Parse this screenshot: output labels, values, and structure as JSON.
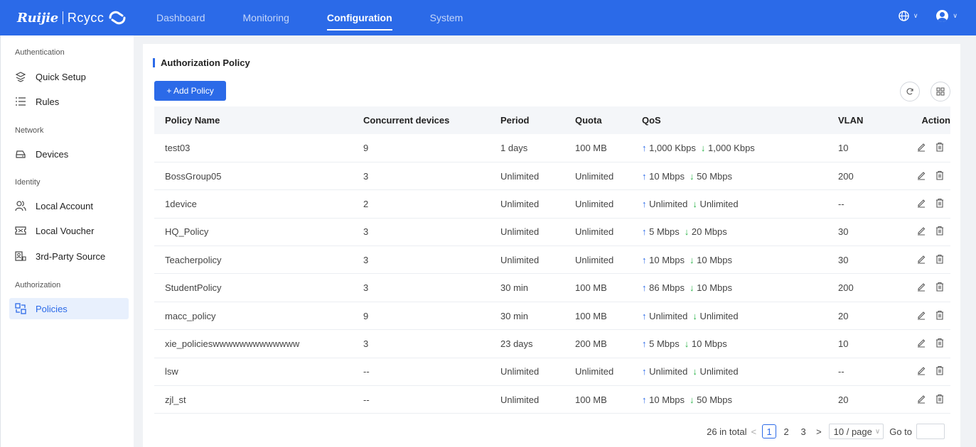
{
  "header": {
    "brand": "Ruijie",
    "product": "Rcycc",
    "tabs": [
      {
        "label": "Dashboard",
        "active": false
      },
      {
        "label": "Monitoring",
        "active": false
      },
      {
        "label": "Configuration",
        "active": true
      },
      {
        "label": "System",
        "active": false
      }
    ],
    "icons": [
      "globe-icon",
      "user-avatar-icon"
    ]
  },
  "sidebar": {
    "groups": {
      "authentication": "Authentication",
      "network": "Network",
      "identity": "Identity",
      "authorization": "Authorization"
    },
    "items": [
      {
        "label": "Quick Setup",
        "icon": "quick-setup-icon"
      },
      {
        "label": "Rules",
        "icon": "list-icon"
      },
      {
        "label": "Devices",
        "icon": "device-icon"
      },
      {
        "label": "Local Account",
        "icon": "users-icon"
      },
      {
        "label": "Local Voucher",
        "icon": "voucher-icon"
      },
      {
        "label": "3rd-Party Source",
        "icon": "third-party-icon"
      },
      {
        "label": "Policies",
        "icon": "policy-icon",
        "active": true
      }
    ]
  },
  "main": {
    "title": "Authorization Policy",
    "add_button": "+ Add Policy",
    "columns": [
      "Policy Name",
      "Concurrent devices",
      "Period",
      "Quota",
      "QoS",
      "VLAN",
      "Action"
    ],
    "rows": [
      {
        "name": "test03",
        "devices": "9",
        "period": "1 days",
        "quota": "100 MB",
        "up": "1,000 Kbps",
        "down": "1,000 Kbps",
        "vlan": "10"
      },
      {
        "name": "BossGroup05",
        "devices": "3",
        "period": "Unlimited",
        "quota": "Unlimited",
        "up": "10 Mbps",
        "down": "50 Mbps",
        "vlan": "200"
      },
      {
        "name": "1device",
        "devices": "2",
        "period": "Unlimited",
        "quota": "Unlimited",
        "up": "Unlimited",
        "down": "Unlimited",
        "vlan": "--"
      },
      {
        "name": "HQ_Policy",
        "devices": "3",
        "period": "Unlimited",
        "quota": "Unlimited",
        "up": "5 Mbps",
        "down": "20 Mbps",
        "vlan": "30"
      },
      {
        "name": "Teacherpolicy",
        "devices": "3",
        "period": "Unlimited",
        "quota": "Unlimited",
        "up": "10 Mbps",
        "down": "10 Mbps",
        "vlan": "30"
      },
      {
        "name": "StudentPolicy",
        "devices": "3",
        "period": "30 min",
        "quota": "100 MB",
        "up": "86 Mbps",
        "down": "10 Mbps",
        "vlan": "200"
      },
      {
        "name": "macc_policy",
        "devices": "9",
        "period": "30 min",
        "quota": "100 MB",
        "up": "Unlimited",
        "down": "Unlimited",
        "vlan": "20"
      },
      {
        "name": "xie_policieswwwwwwwwwwwww",
        "devices": "3",
        "period": "23 days",
        "quota": "200 MB",
        "up": "5 Mbps",
        "down": "10 Mbps",
        "vlan": "10"
      },
      {
        "name": "lsw",
        "devices": "--",
        "period": "Unlimited",
        "quota": "Unlimited",
        "up": "Unlimited",
        "down": "Unlimited",
        "vlan": "--"
      },
      {
        "name": "zjl_st",
        "devices": "--",
        "period": "Unlimited",
        "quota": "100 MB",
        "up": "10 Mbps",
        "down": "50 Mbps",
        "vlan": "20"
      }
    ]
  },
  "pagination": {
    "total": "26 in total",
    "pages": [
      "1",
      "2",
      "3"
    ],
    "current": "1",
    "page_size": "10 / page",
    "goto_label": "Go to"
  },
  "colors": {
    "primary": "#2b6ae8",
    "qos_up": "#2b6ae8",
    "qos_down": "#2cb44a"
  }
}
